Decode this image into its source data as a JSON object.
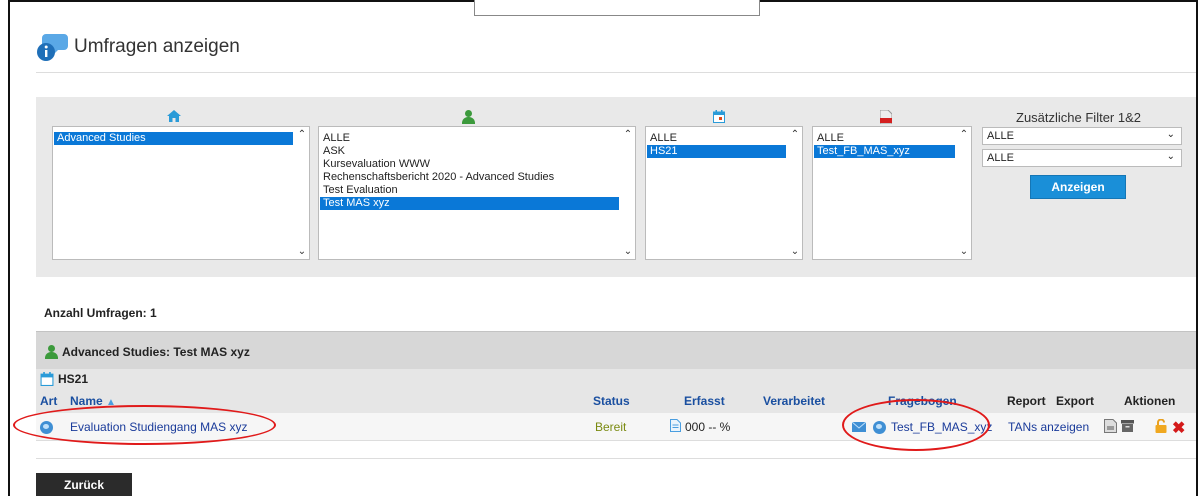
{
  "page": {
    "title": "Umfragen anzeigen"
  },
  "filters": {
    "list_home": {
      "options": [
        "Advanced Studies"
      ],
      "selected": "Advanced Studies"
    },
    "list_person": {
      "options": [
        "ALLE",
        "ASK",
        "Kursevaluation WWW",
        "Rechenschaftsbericht 2020 - Advanced Studies",
        "Test Evaluation",
        "Test MAS xyz"
      ],
      "selected": "Test MAS xyz"
    },
    "list_calendar": {
      "options": [
        "ALLE",
        "HS21"
      ],
      "selected": "HS21"
    },
    "list_pdf": {
      "options": [
        "ALLE",
        "Test_FB_MAS_xyz"
      ],
      "selected": "Test_FB_MAS_xyz"
    },
    "extra_label": "Zusätzliche Filter 1&2",
    "select1_value": "ALLE",
    "select2_value": "ALLE",
    "show_button": "Anzeigen"
  },
  "results": {
    "count_label": "Anzahl Umfragen: 1",
    "group_label": "Advanced Studies: Test MAS xyz",
    "semester_label": "HS21",
    "headers": {
      "art": "Art",
      "name": "Name",
      "status": "Status",
      "erfasst": "Erfasst",
      "verarbeitet": "Verarbeitet",
      "fragebogen": "Fragebogen",
      "report": "Report",
      "export": "Export",
      "aktionen": "Aktionen"
    },
    "rows": [
      {
        "name": "Evaluation Studiengang MAS xyz",
        "status": "Bereit",
        "erfasst": "000 -- %",
        "fragebogen": "Test_FB_MAS_xyz",
        "tans": "TANs anzeigen"
      }
    ]
  },
  "colors": {
    "accent": "#0a78d7",
    "status_ready": "#7a8a10",
    "link": "#1a3b9a",
    "annotation": "#e01a1a"
  },
  "back_button": "Zurück"
}
